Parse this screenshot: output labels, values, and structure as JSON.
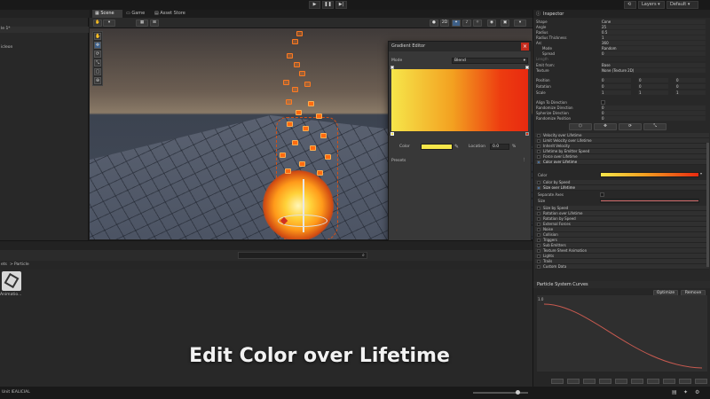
{
  "toolbar": {
    "layers": "Layers",
    "layout": "Default"
  },
  "hierarchy": {
    "scene_label": "le 1*",
    "item": "icleon"
  },
  "scene_tabs": [
    "Scene",
    "Game",
    "Asset Store"
  ],
  "gradient_editor": {
    "title": "Gradient Editor",
    "mode_label": "Mode",
    "mode_value": "Blend",
    "color_label": "Color",
    "location_label": "Location",
    "location_value": "0.0",
    "location_unit": "%",
    "presets_label": "Presets",
    "colors": {
      "start": "#f6e64a",
      "mid": "#f3a020",
      "end": "#e82a10"
    }
  },
  "project": {
    "breadcrumb_root": "ets",
    "breadcrumb_sep": ">",
    "breadcrumb_folder": "Particle",
    "asset_name": "Animatio..."
  },
  "caption": "Edit Color over Lifetime",
  "inspector": {
    "title": "Inspector",
    "top_rows": [
      {
        "label": "Shape",
        "value": "Cone"
      },
      {
        "label": "Angle",
        "value": "25"
      },
      {
        "label": "Radius",
        "value": "0.5"
      },
      {
        "label": "Radius Thickness",
        "value": "1"
      },
      {
        "label": "Arc",
        "value": "360"
      },
      {
        "label": "Mode",
        "value": "Random"
      },
      {
        "label": "Spread",
        "value": "0"
      },
      {
        "label": "Length",
        "value": ""
      },
      {
        "label": "Emit from:",
        "value": "Base"
      },
      {
        "label": "Texture",
        "value": "None (Texture 2D)"
      }
    ],
    "transform": [
      {
        "label": "Position",
        "x": "0",
        "y": "0",
        "z": "0"
      },
      {
        "label": "Rotation",
        "x": "0",
        "y": "0",
        "z": "0"
      },
      {
        "label": "Scale",
        "x": "1",
        "y": "1",
        "z": "1"
      }
    ],
    "misc_rows": [
      {
        "label": "Align To Direction"
      },
      {
        "label": "Randomize Direction",
        "value": "0"
      },
      {
        "label": "Spherize Direction",
        "value": "0"
      },
      {
        "label": "Randomize Position",
        "value": "0"
      }
    ],
    "modules_top": [
      "Velocity over Lifetime",
      "Limit Velocity over Lifetime",
      "Inherit Velocity",
      "Lifetime by Emitter Speed",
      "Force over Lifetime",
      "Color over Lifetime"
    ],
    "color_label": "Color",
    "modules_mid": [
      "Color by Speed",
      "Size over Lifetime"
    ],
    "separate_axes": "Separate Axes",
    "size_label": "Size",
    "modules_bottom": [
      "Size by Speed",
      "Rotation over Lifetime",
      "Rotation by Speed",
      "External Forces",
      "Noise",
      "Collision",
      "Triggers",
      "Sub Emitters",
      "Texture Sheet Animation",
      "Lights",
      "Trails",
      "Custom Data"
    ]
  },
  "curves": {
    "title": "Particle System Curves",
    "optimize": "Optimize",
    "remove": "Remove",
    "y_tick": "1.0"
  },
  "status": {
    "left": "Unit IEALICIAL"
  }
}
